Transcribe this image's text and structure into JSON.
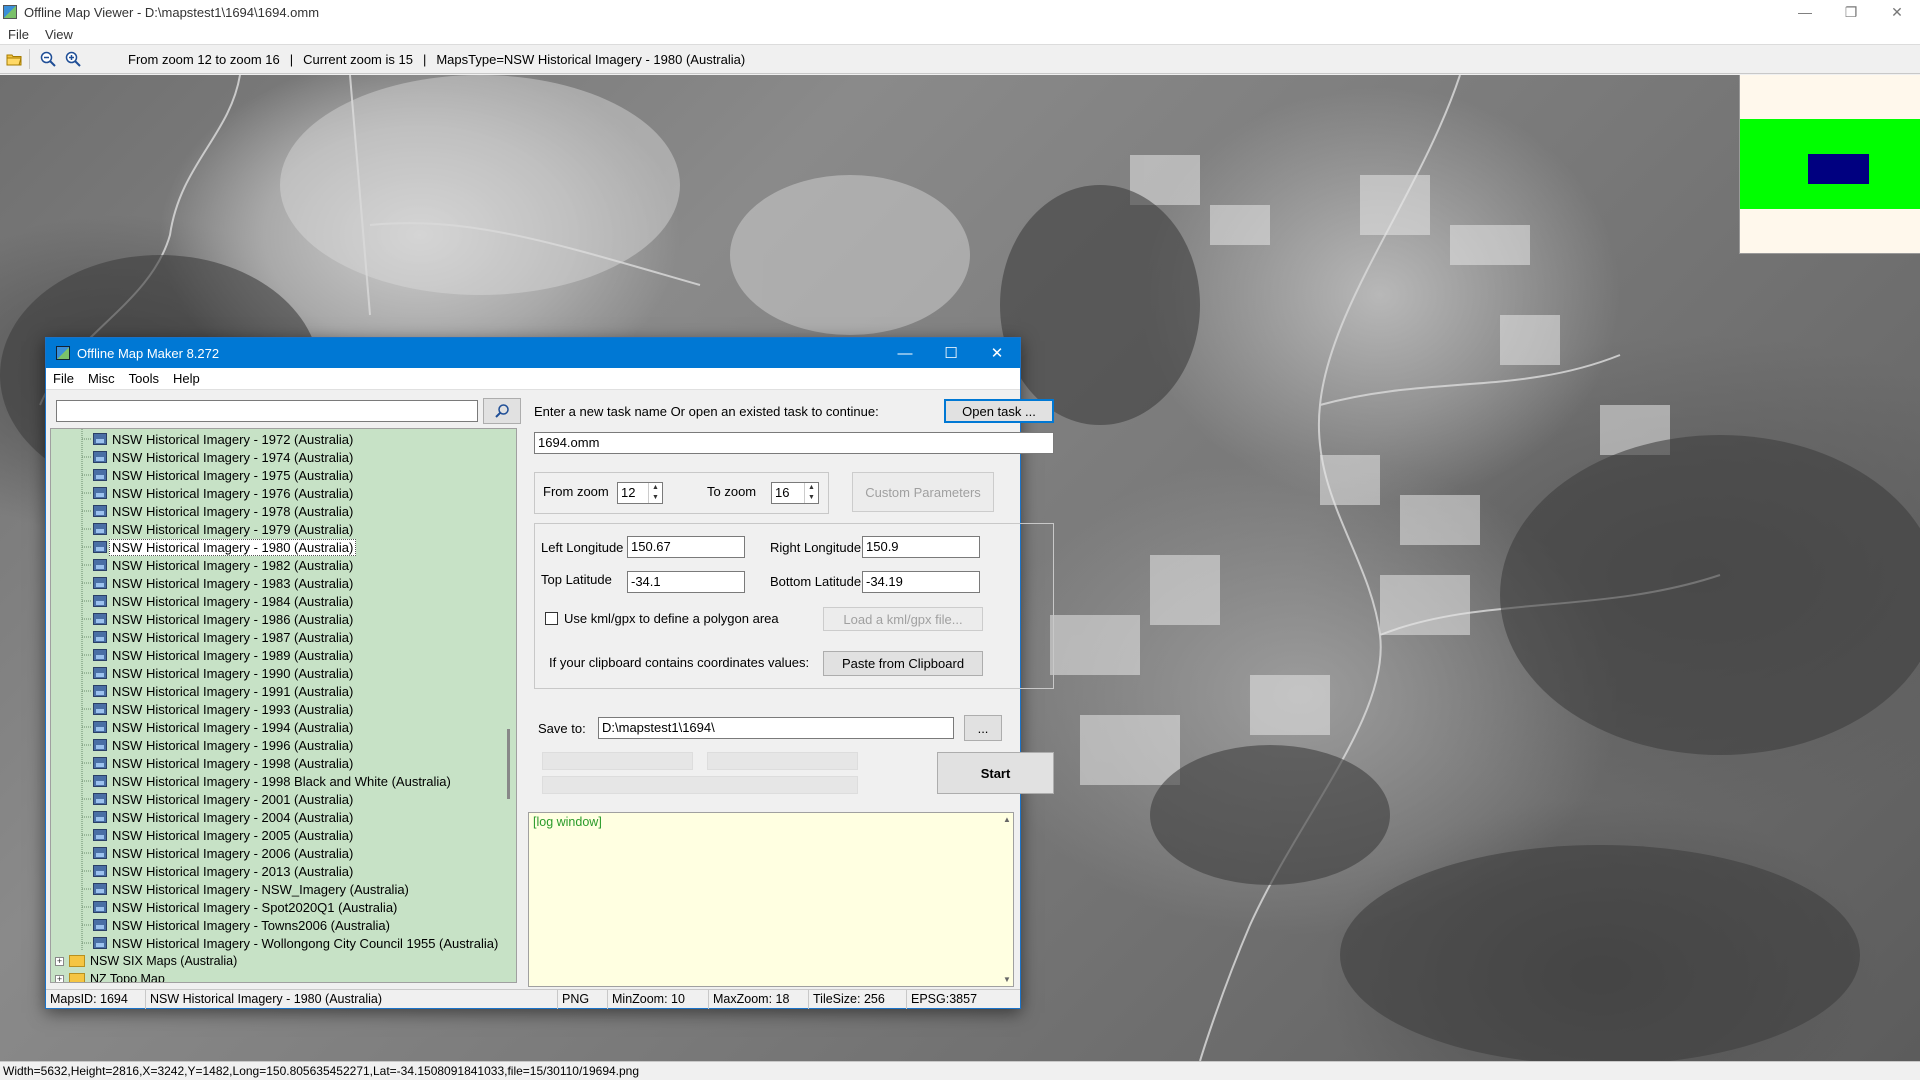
{
  "viewer": {
    "title": "Offline Map Viewer - D:\\mapstest1\\1694\\1694.omm",
    "menu": [
      "File",
      "View"
    ],
    "toolbar": {
      "zoom_range": "From zoom 12 to zoom 16",
      "separator": "|",
      "current_zoom": "Current zoom is 15",
      "separator2": "|",
      "maps_type": "MapsType=NSW Historical Imagery - 1980 (Australia)"
    },
    "status": "Width=5632,Height=2816,X=3242,Y=1482,Long=150.805635452271,Lat=-34.1508091841033,file=15/30110/19694.png"
  },
  "minimap": {
    "background": "#fff8ec",
    "band_color": "#00ff00",
    "view_color": "#000080"
  },
  "dialog": {
    "title": "Offline Map Maker 8.272",
    "menu": [
      "File",
      "Misc",
      "Tools",
      "Help"
    ],
    "search": {
      "value": "",
      "placeholder": ""
    },
    "tree": {
      "items": [
        "NSW Historical Imagery - 1972 (Australia)",
        "NSW Historical Imagery - 1974 (Australia)",
        "NSW Historical Imagery - 1975 (Australia)",
        "NSW Historical Imagery - 1976 (Australia)",
        "NSW Historical Imagery - 1978 (Australia)",
        "NSW Historical Imagery - 1979 (Australia)",
        "NSW Historical Imagery - 1980 (Australia)",
        "NSW Historical Imagery - 1982 (Australia)",
        "NSW Historical Imagery - 1983 (Australia)",
        "NSW Historical Imagery - 1984 (Australia)",
        "NSW Historical Imagery - 1986 (Australia)",
        "NSW Historical Imagery - 1987 (Australia)",
        "NSW Historical Imagery - 1989 (Australia)",
        "NSW Historical Imagery - 1990 (Australia)",
        "NSW Historical Imagery - 1991 (Australia)",
        "NSW Historical Imagery - 1993 (Australia)",
        "NSW Historical Imagery - 1994 (Australia)",
        "NSW Historical Imagery - 1996 (Australia)",
        "NSW Historical Imagery - 1998 (Australia)",
        "NSW Historical Imagery - 1998 Black and White (Australia)",
        "NSW Historical Imagery - 2001 (Australia)",
        "NSW Historical Imagery - 2004 (Australia)",
        "NSW Historical Imagery - 2005 (Australia)",
        "NSW Historical Imagery - 2006 (Australia)",
        "NSW Historical Imagery - 2013 (Australia)",
        "NSW Historical Imagery - NSW_Imagery (Australia)",
        "NSW Historical Imagery - Spot2020Q1 (Australia)",
        "NSW Historical Imagery - Towns2006 (Australia)",
        "NSW Historical Imagery - Wollongong City Council 1955 (Australia)"
      ],
      "selected": "NSW Historical Imagery - 1980 (Australia)",
      "folders": [
        "NSW SIX Maps (Australia)",
        "NZ Topo Map"
      ],
      "background": "#c7e2c6"
    },
    "task_prompt": "Enter a new task name Or open an existed task to continue:",
    "open_task_label": "Open task ...",
    "task_name": "1694.omm",
    "from_zoom_label": "From zoom",
    "from_zoom_value": "12",
    "to_zoom_label": "To zoom",
    "to_zoom_value": "16",
    "custom_params_label": "Custom Parameters",
    "left_long_label": "Left Longitude",
    "left_long_value": "150.67",
    "right_long_label": "Right Longitude",
    "right_long_value": "150.9",
    "top_lat_label": "Top Latitude",
    "top_lat_value": "-34.1",
    "bottom_lat_label": "Bottom Latitude",
    "bottom_lat_value": "-34.19",
    "kml_checkbox_label": "Use kml/gpx to define a polygon area",
    "kml_checked": false,
    "load_kml_label": "Load a kml/gpx file...",
    "clipboard_prompt": "If your clipboard contains coordinates values:",
    "paste_label": "Paste from Clipboard",
    "save_to_label": "Save to:",
    "save_to_value": "D:\\mapstest1\\1694\\",
    "browse_label": "...",
    "start_label": "Start",
    "log_text": "[log window]",
    "status": {
      "maps_id": "MapsID: 1694",
      "maps_name": "NSW Historical Imagery - 1980 (Australia)",
      "format": "PNG",
      "min_zoom": "MinZoom: 10",
      "max_zoom": "MaxZoom: 18",
      "tile_size": "TileSize: 256",
      "epsg": "EPSG:3857"
    }
  }
}
